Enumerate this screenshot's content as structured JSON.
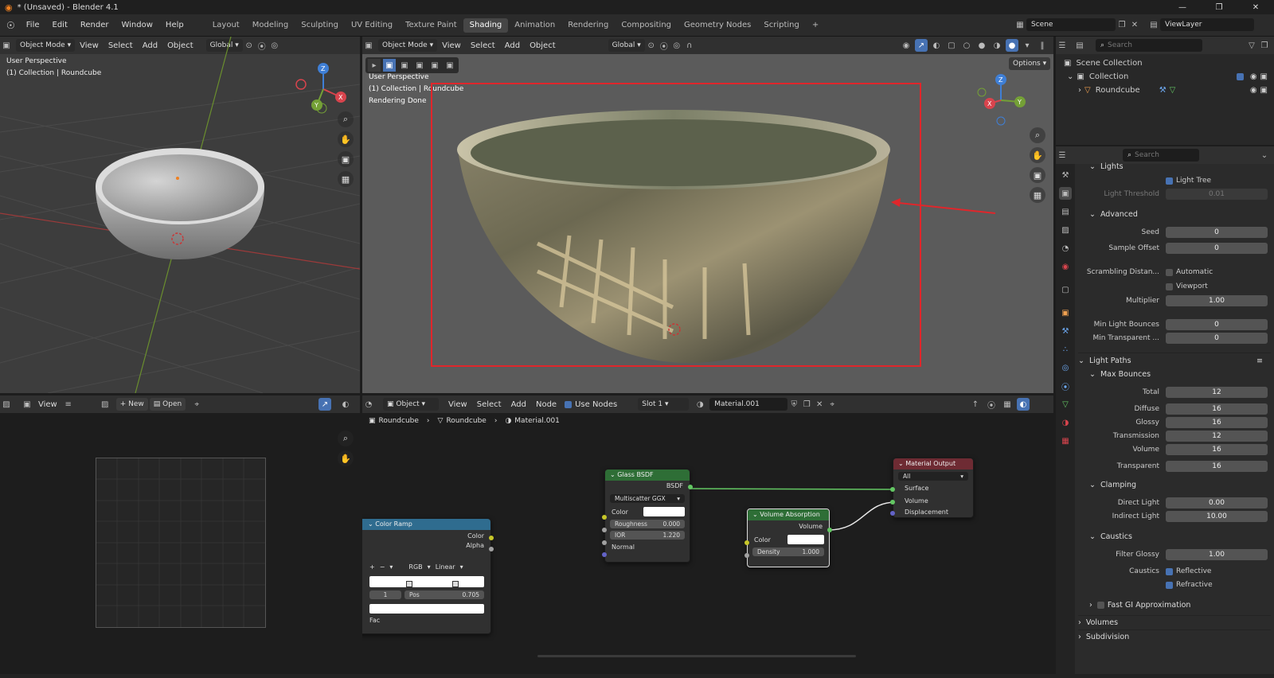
{
  "window": {
    "title": "* (Unsaved) - Blender 4.1"
  },
  "menu": {
    "items": [
      "File",
      "Edit",
      "Render",
      "Window",
      "Help"
    ]
  },
  "workspaces": [
    "Layout",
    "Modeling",
    "Sculpting",
    "UV Editing",
    "Texture Paint",
    "Shading",
    "Animation",
    "Rendering",
    "Compositing",
    "Geometry Nodes",
    "Scripting"
  ],
  "active_workspace": "Shading",
  "scene": {
    "name": "Scene",
    "view_layer": "ViewLayer"
  },
  "left_viewport": {
    "mode": "Object Mode",
    "view": "View",
    "select": "Select",
    "add": "Add",
    "object": "Object",
    "orientation": "Global",
    "info_line1": "User Perspective",
    "info_line2": "(1) Collection | Roundcube"
  },
  "main_viewport": {
    "mode": "Object Mode",
    "view": "View",
    "select": "Select",
    "add": "Add",
    "object": "Object",
    "orientation": "Global",
    "options": "Options",
    "info_line1": "User Perspective",
    "info_line2": "(1) Collection | Roundcube",
    "info_line3": "Rendering Done"
  },
  "image_editor": {
    "view": "View",
    "new": "New",
    "open": "Open"
  },
  "node_editor": {
    "object": "Object",
    "view": "View",
    "select": "Select",
    "add": "Add",
    "node": "Node",
    "use_nodes": "Use Nodes",
    "slot": "Slot 1",
    "material": "Material.001",
    "breadcrumb": [
      "Roundcube",
      "Roundcube",
      "Material.001"
    ]
  },
  "nodes": {
    "glass": {
      "title": "Glass BSDF",
      "output": "BSDF",
      "distribution": "Multiscatter GGX",
      "color": "Color",
      "roughness_label": "Roughness",
      "roughness": "0.000",
      "ior_label": "IOR",
      "ior": "1.220",
      "normal": "Normal"
    },
    "volume": {
      "title": "Volume Absorption",
      "output": "Volume",
      "color": "Color",
      "density_label": "Density",
      "density": "1.000"
    },
    "output": {
      "title": "Material Output",
      "target": "All",
      "surface": "Surface",
      "volume": "Volume",
      "displacement": "Displacement"
    },
    "ramp": {
      "title": "Color Ramp",
      "color": "Color",
      "alpha": "Alpha",
      "mode": "RGB",
      "interp": "Linear",
      "index": "1",
      "pos_label": "Pos",
      "pos": "0.705",
      "fac": "Fac"
    }
  },
  "outliner": {
    "search_placeholder": "Search",
    "scene_collection": "Scene Collection",
    "collection": "Collection",
    "object": "Roundcube"
  },
  "properties": {
    "search_placeholder": "Search",
    "lights": "Lights",
    "light_tree": "Light Tree",
    "light_threshold_label": "Light Threshold",
    "light_threshold": "0.01",
    "advanced": "Advanced",
    "seed_label": "Seed",
    "seed": "0",
    "sample_offset_label": "Sample Offset",
    "sample_offset": "0",
    "scrambling_label": "Scrambling Distan...",
    "automatic": "Automatic",
    "viewport": "Viewport",
    "multiplier_label": "Multiplier",
    "multiplier": "1.00",
    "min_light_bounces_label": "Min Light Bounces",
    "min_light_bounces": "0",
    "min_transparent_label": "Min Transparent ...",
    "min_transparent": "0",
    "light_paths": "Light Paths",
    "max_bounces": "Max Bounces",
    "total_label": "Total",
    "total": "12",
    "diffuse_label": "Diffuse",
    "diffuse": "16",
    "glossy_label": "Glossy",
    "glossy": "16",
    "transmission_label": "Transmission",
    "transmission": "12",
    "volume_label": "Volume",
    "volume": "16",
    "transparent_label": "Transparent",
    "transparent": "16",
    "clamping": "Clamping",
    "direct_light_label": "Direct Light",
    "direct_light": "0.00",
    "indirect_light_label": "Indirect Light",
    "indirect_light": "10.00",
    "caustics": "Caustics",
    "filter_glossy_label": "Filter Glossy",
    "filter_glossy": "1.00",
    "caustics_label": "Caustics",
    "reflective": "Reflective",
    "refractive": "Refractive",
    "fast_gi": "Fast GI Approximation",
    "volumes": "Volumes",
    "subdivision": "Subdivision"
  },
  "colors": {
    "accent": "#4772b3",
    "annotation": "#e0262b",
    "glass_header": "#2e6e36",
    "volume_header": "#2e6e36",
    "output_header": "#6e2b33",
    "ramp_header": "#2f6c8f"
  }
}
